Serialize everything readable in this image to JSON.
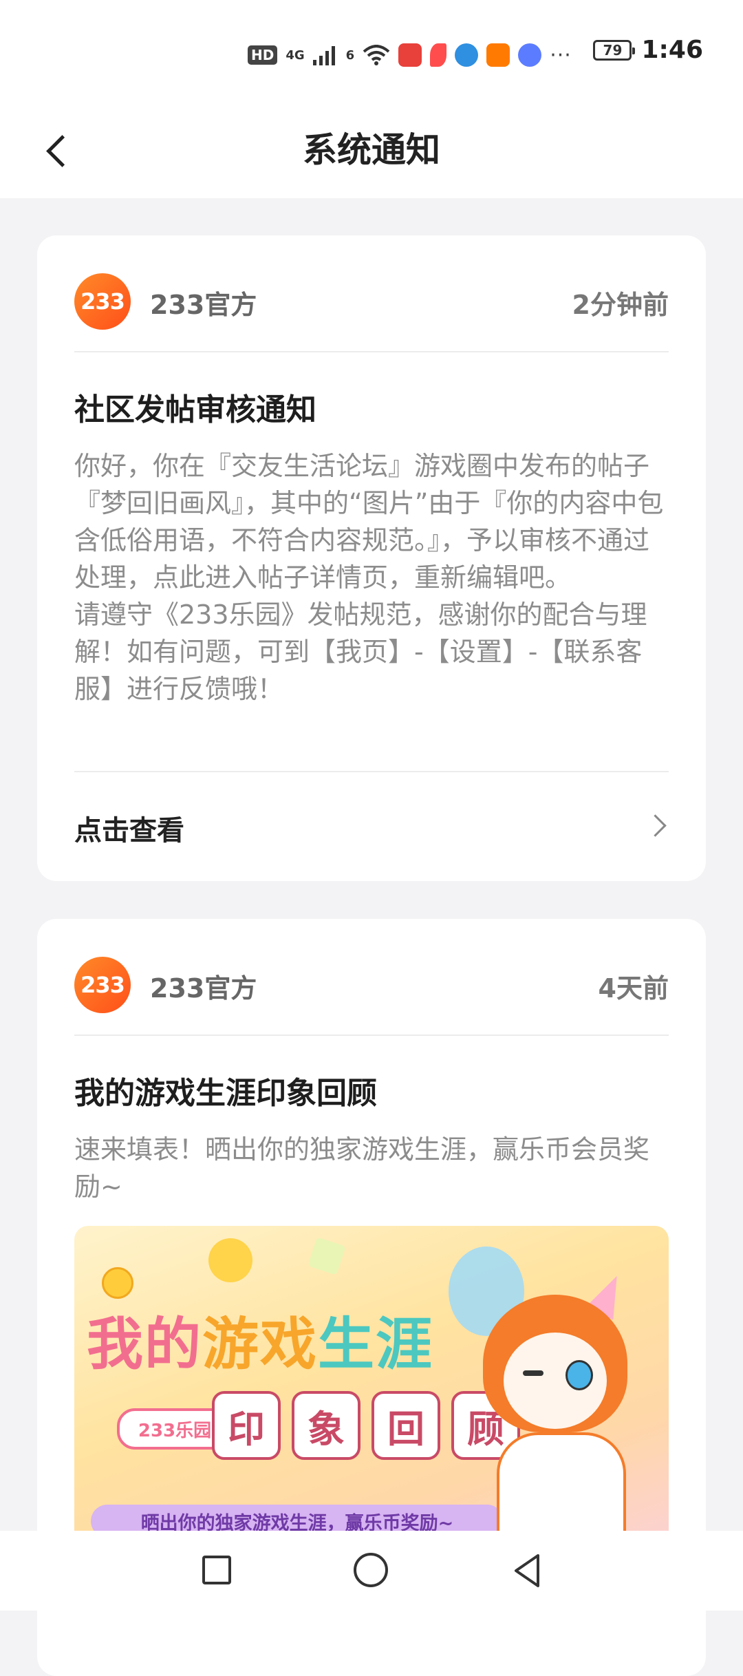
{
  "status_bar": {
    "hd": "HD",
    "signal_1": "4G",
    "signal_2": "6",
    "battery": "79",
    "time": "1:46",
    "overflow": "···"
  },
  "header": {
    "title": "系统通知"
  },
  "notifications": [
    {
      "logo_text": "233",
      "sender": "233官方",
      "time": "2分钟前",
      "title": "社区发帖审核通知",
      "body_1": "你好，你在『交友生活论坛』游戏圈中发布的帖子『梦回旧画风』，其中的“图片”由于『你的内容中包含低俗用语，不符合内容规范。』，予以审核不通过处理，点此进入帖子详情页，重新编辑吧。",
      "body_2": "请遵守《233乐园》发帖规范，感谢你的配合与理解！如有问题，可到【我页】-【设置】-【联系客服】进行反馈哦！",
      "action": "点击查看"
    },
    {
      "logo_text": "233",
      "sender": "233官方",
      "time": "4天前",
      "title": "我的游戏生涯印象回顾",
      "body_1": "速来填表！晒出你的独家游戏生涯，赢乐币会员奖励~",
      "banner": {
        "title_a": "我的",
        "title_b": "游戏",
        "title_c": "生涯",
        "badge": "233乐园",
        "subtitle_chars": [
          "印",
          "象",
          "回",
          "顾"
        ],
        "strip": "晒出你的独家游戏生涯，赢乐币奖励~"
      }
    }
  ],
  "colors": {
    "brand_orange": "#ff6a22",
    "background": "#f3f3f5",
    "card": "#ffffff"
  }
}
